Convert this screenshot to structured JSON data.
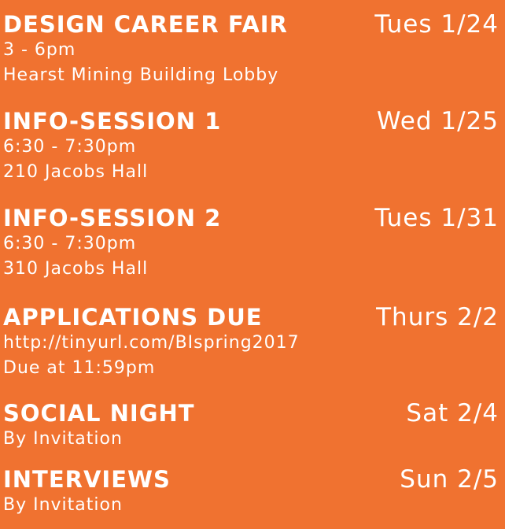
{
  "events": [
    {
      "title": "DESIGN CAREER FAIR",
      "date": "Tues 1/24",
      "details": [
        "3 - 6pm",
        "Hearst Mining Building Lobby"
      ]
    },
    {
      "title": "INFO-SESSION 1",
      "date": "Wed 1/25",
      "details": [
        "6:30 - 7:30pm",
        "210 Jacobs Hall"
      ]
    },
    {
      "title": "INFO-SESSION 2",
      "date": "Tues 1/31",
      "details": [
        "6:30 - 7:30pm",
        "310 Jacobs Hall"
      ]
    },
    {
      "title": "APPLICATIONS DUE",
      "date": "Thurs 2/2",
      "details": [
        "http://tinyurl.com/BIspring2017",
        "Due at 11:59pm"
      ]
    },
    {
      "title": "SOCIAL NIGHT",
      "date": "Sat 2/4",
      "details": [
        "By Invitation"
      ]
    },
    {
      "title": "INTERVIEWS",
      "date": "Sun 2/5",
      "details": [
        "By Invitation"
      ]
    }
  ],
  "colors": {
    "background": "#F07230",
    "text": "#FFFFFF"
  }
}
